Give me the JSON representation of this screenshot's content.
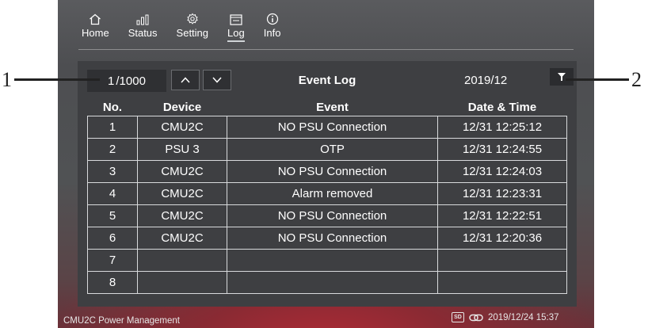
{
  "nav": [
    {
      "label": "Home",
      "icon": "home-icon"
    },
    {
      "label": "Status",
      "icon": "bar-chart-icon"
    },
    {
      "label": "Setting",
      "icon": "gear-icon"
    },
    {
      "label": "Log",
      "icon": "log-icon",
      "active": true
    },
    {
      "label": "Info",
      "icon": "info-icon"
    }
  ],
  "log": {
    "page_current": "1",
    "page_total": "/1000",
    "title": "Event Log",
    "date_filter": "2019/12",
    "columns": [
      "No.",
      "Device",
      "Event",
      "Date & Time"
    ],
    "rows": [
      {
        "no": "1",
        "device": "CMU2C",
        "event": "NO PSU Connection",
        "datetime": "12/31 12:25:12"
      },
      {
        "no": "2",
        "device": "PSU 3",
        "event": "OTP",
        "datetime": "12/31 12:24:55"
      },
      {
        "no": "3",
        "device": "CMU2C",
        "event": "NO PSU Connection",
        "datetime": "12/31 12:24:03"
      },
      {
        "no": "4",
        "device": "CMU2C",
        "event": "Alarm removed",
        "datetime": "12/31 12:23:31"
      },
      {
        "no": "5",
        "device": "CMU2C",
        "event": "NO PSU Connection",
        "datetime": "12/31 12:22:51"
      },
      {
        "no": "6",
        "device": "CMU2C",
        "event": "NO PSU Connection",
        "datetime": "12/31 12:20:36"
      },
      {
        "no": "7",
        "device": "",
        "event": "",
        "datetime": ""
      },
      {
        "no": "8",
        "device": "",
        "event": "",
        "datetime": ""
      }
    ]
  },
  "footer": {
    "app_name": "CMU2C Power Management",
    "sd_label": "SD",
    "timestamp": "2019/12/24 15:37"
  },
  "callouts": {
    "left": "1",
    "right": "2"
  }
}
